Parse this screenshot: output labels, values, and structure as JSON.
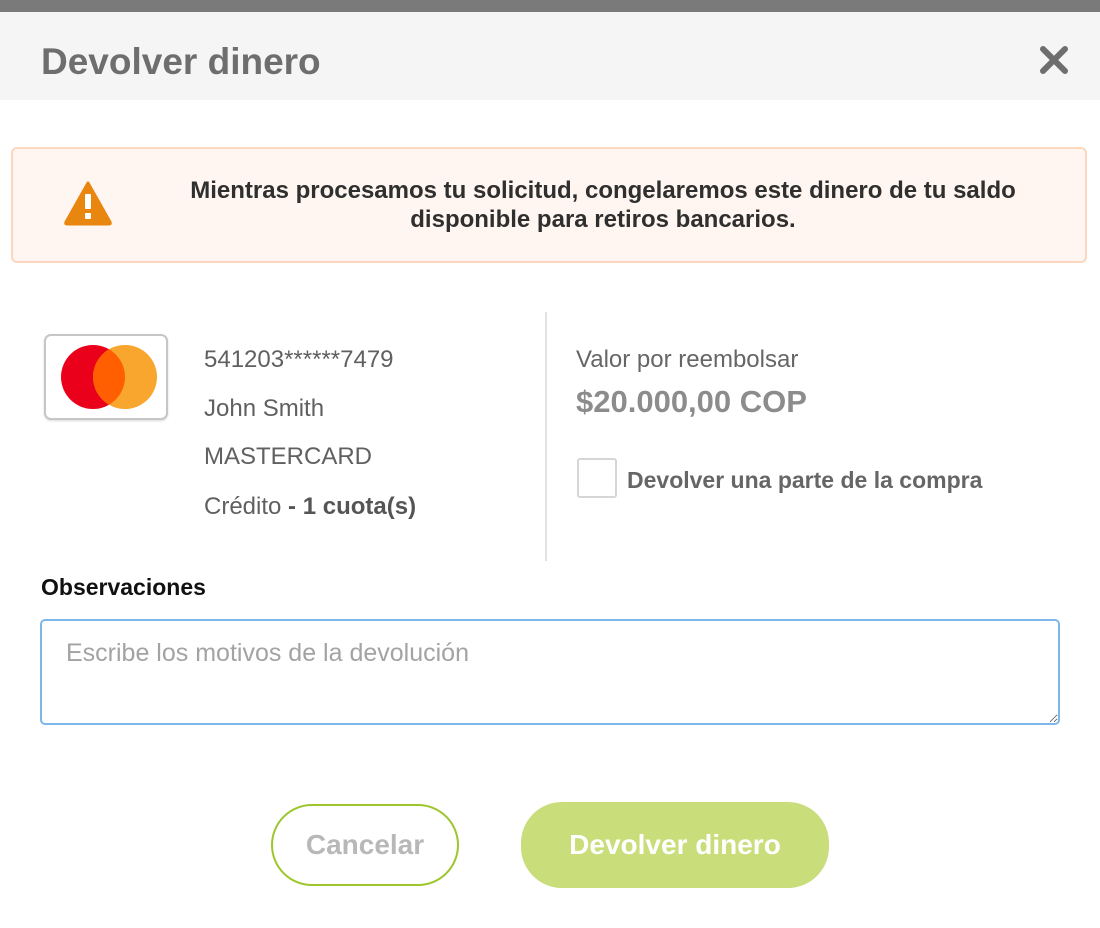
{
  "modal": {
    "title": "Devolver dinero",
    "close_icon": "close-icon"
  },
  "alert": {
    "icon": "warning-icon",
    "message": "Mientras procesamos tu solicitud, congelaremos este dinero de tu saldo disponible para retiros bancarios."
  },
  "card": {
    "logo_icon": "mastercard-logo",
    "number": "541203******7479",
    "holder": "John Smith",
    "brand": "MASTERCARD",
    "type": "Crédito",
    "installments": "- 1 cuota(s)"
  },
  "refund": {
    "label": "Valor por reembolsar",
    "amount": "$20.000,00 COP",
    "partial_label": "Devolver una parte de la compra",
    "partial_checked": false
  },
  "observations": {
    "label": "Observaciones",
    "placeholder": "Escribe los motivos de la devolución",
    "value": ""
  },
  "actions": {
    "cancel_label": "Cancelar",
    "submit_label": "Devolver dinero"
  },
  "colors": {
    "accent_green": "#9cc62b",
    "submit_bg": "#c9dd7a",
    "warning_orange": "#e8860f",
    "alert_bg": "#fff6f1",
    "input_border": "#7db8e8"
  }
}
